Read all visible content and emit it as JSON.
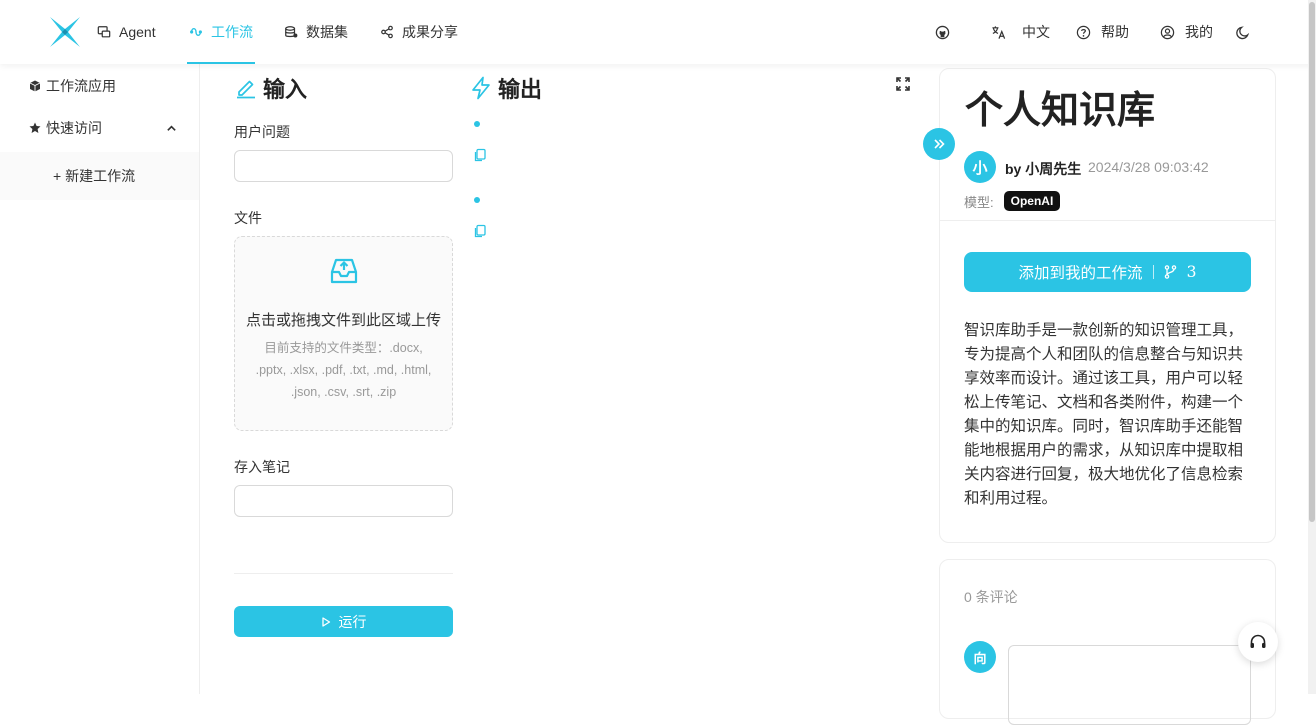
{
  "nav": {
    "items": [
      {
        "label": "Agent",
        "icon": "chat-icon"
      },
      {
        "label": "工作流",
        "icon": "workflow-icon"
      },
      {
        "label": "数据集",
        "icon": "database-icon"
      },
      {
        "label": "成果分享",
        "icon": "share-icon"
      }
    ],
    "active_index": 1,
    "right": {
      "language": "中文",
      "help": "帮助",
      "mine": "我的"
    }
  },
  "sidebar": {
    "workflow_apps": "工作流应用",
    "quick_access": "快速访问",
    "new_workflow": "+ 新建工作流"
  },
  "input_panel": {
    "title": "输入",
    "question_label": "用户问题",
    "file_label": "文件",
    "upload_title": "点击或拖拽文件到此区域上传",
    "upload_hint": "目前支持的文件类型：.docx, .pptx, .xlsx, .pdf, .txt, .md, .html, .json, .csv, .srt, .zip",
    "note_label": "存入笔记",
    "run_label": "运行"
  },
  "output_panel": {
    "title": "输出"
  },
  "detail": {
    "title": "个人知识库",
    "avatar_char": "小",
    "author": "by 小周先生",
    "date": "2024/3/28 09:03:42",
    "model_label": "模型:",
    "model_value": "OpenAI",
    "add_label": "添加到我的工作流",
    "fork_count": "3",
    "description": "智识库助手是一款创新的知识管理工具，专为提高个人和团队的信息整合与知识共享效率而设计。通过该工具，用户可以轻松上传笔记、文档和各类附件，构建一个集中的知识库。同时，智识库助手还能智能地根据用户的需求，从知识库中提取相关内容进行回复，极大地优化了信息检索和利用过程。"
  },
  "comments": {
    "count_label": "0 条评论",
    "avatar_char": "向"
  },
  "colors": {
    "accent": "#2bc4e4",
    "badge": "#111111"
  }
}
